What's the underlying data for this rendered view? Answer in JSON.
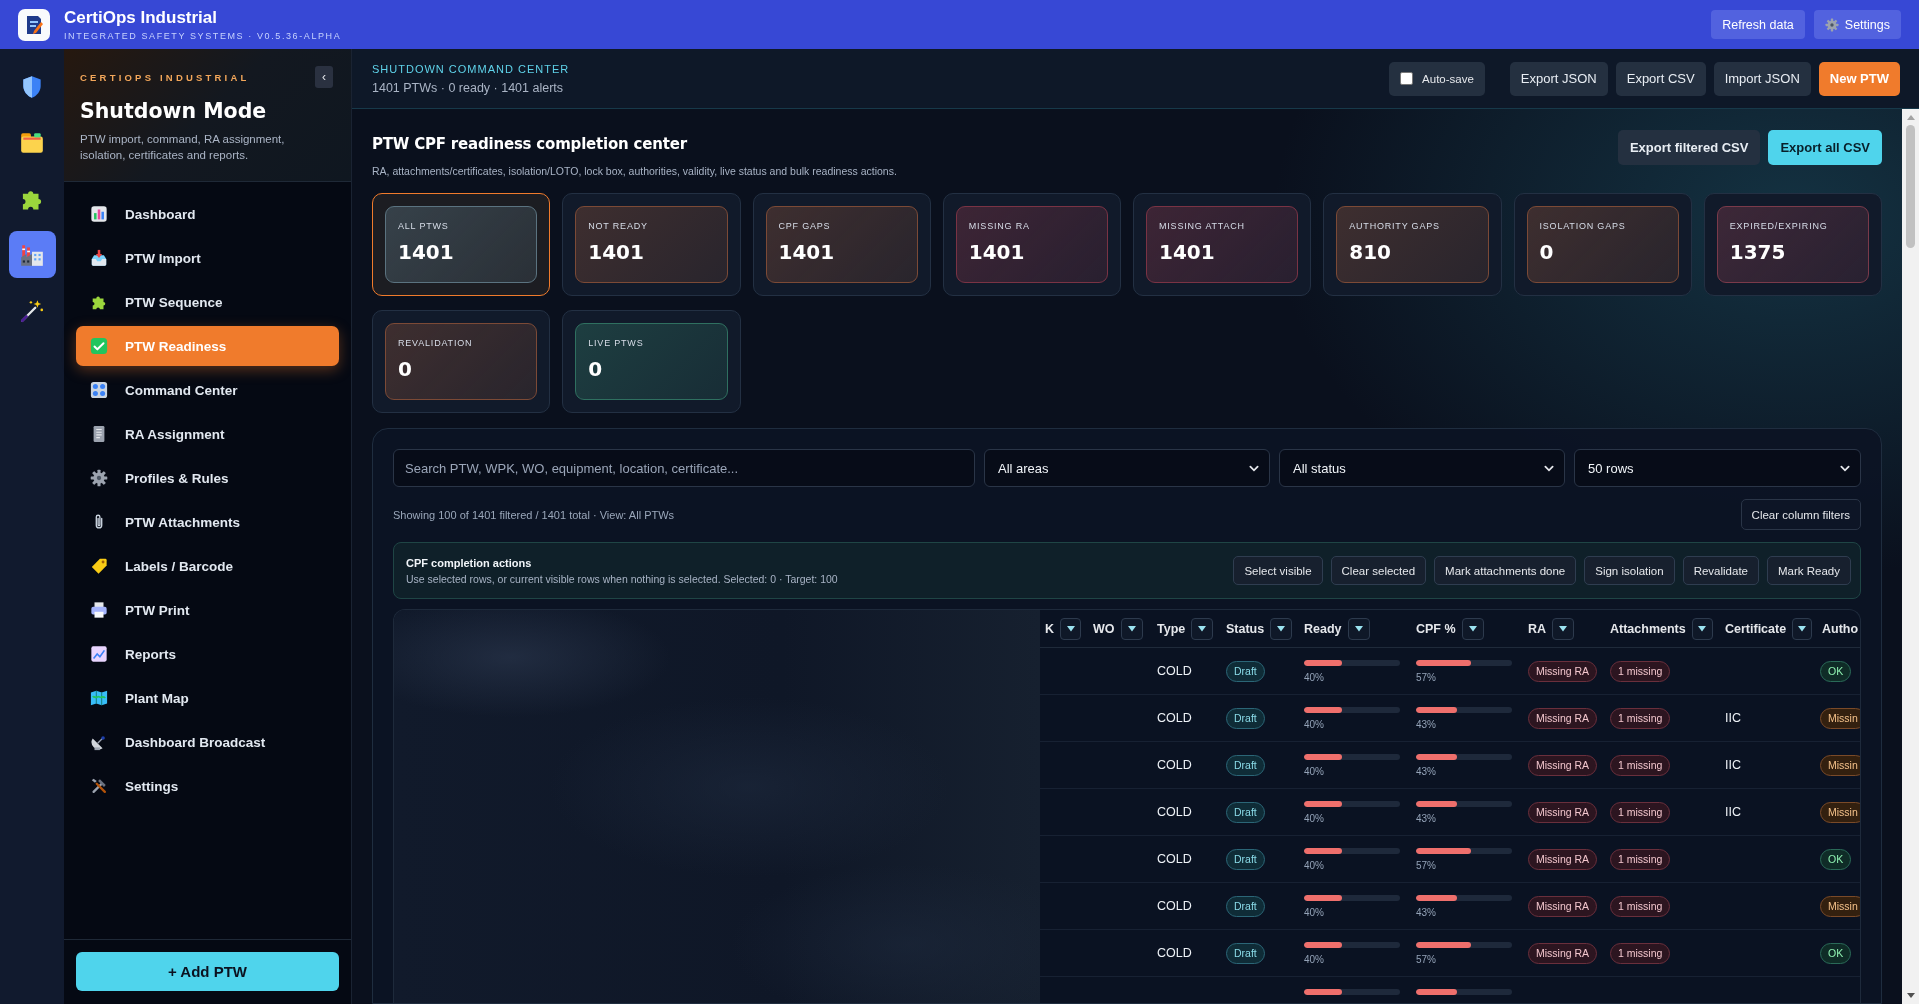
{
  "app_bar": {
    "title": "CertiOps Industrial",
    "subtitle": "INTEGRATED SAFETY SYSTEMS · V0.5.36-ALPHA",
    "buttons": [
      {
        "label": "Refresh data",
        "kind": "text"
      },
      {
        "label": "Settings",
        "kind": "icon_text"
      }
    ]
  },
  "rail_items": [
    {
      "selected": false
    },
    {
      "selected": false
    },
    {
      "selected": false
    },
    {
      "selected": true
    },
    {
      "selected": false
    }
  ],
  "sidebar": {
    "eyebrow": "CERTIOPS INDUSTRIAL",
    "collapse_button": "‹",
    "title": "Shutdown Mode",
    "description": "PTW import, command, RA assignment, isolation, certificates and reports.",
    "items": [
      {
        "label": "Dashboard",
        "selected": false
      },
      {
        "label": "PTW Import",
        "selected": false
      },
      {
        "label": "PTW Sequence",
        "selected": false
      },
      {
        "label": "PTW Readiness",
        "selected": true
      },
      {
        "label": "Command Center",
        "selected": false
      },
      {
        "label": "RA Assignment",
        "selected": false
      },
      {
        "label": "Profiles & Rules",
        "selected": false
      },
      {
        "label": "PTW Attachments",
        "selected": false
      },
      {
        "label": "Labels / Barcode",
        "selected": false
      },
      {
        "label": "PTW Print",
        "selected": false
      },
      {
        "label": "Reports",
        "selected": false
      },
      {
        "label": "Plant Map",
        "selected": false
      },
      {
        "label": "Dashboard Broadcast",
        "selected": false
      },
      {
        "label": "Settings",
        "selected": false
      }
    ],
    "add_button": "+ Add PTW"
  },
  "header": {
    "eyebrow": "SHUTDOWN COMMAND CENTER",
    "summary": "1401 PTWs · 0 ready · 1401 alerts",
    "auto_save": {
      "label": "Auto-save",
      "checked": false
    },
    "buttons": [
      {
        "label": "Export JSON",
        "kind": "secondary"
      },
      {
        "label": "Export CSV",
        "kind": "secondary"
      },
      {
        "label": "Import JSON",
        "kind": "secondary"
      },
      {
        "label": "New PTW",
        "kind": "primary"
      }
    ]
  },
  "section": {
    "title": "PTW CPF readiness completion center",
    "subtitle": "RA, attachments/certificates, isolation/LOTO, lock box, authorities, validity, live status and bulk readiness actions.",
    "buttons": [
      {
        "label": "Export filtered CSV",
        "kind": "secondary"
      },
      {
        "label": "Export all CSV",
        "kind": "accent"
      }
    ]
  },
  "kpis": [
    {
      "label": "ALL PTWS",
      "value": "1401",
      "color": "#5b7380",
      "selected": true
    },
    {
      "label": "NOT READY",
      "value": "1401",
      "color": "#7c4a36",
      "selected": false
    },
    {
      "label": "CPF GAPS",
      "value": "1401",
      "color": "#7c4a36",
      "selected": false
    },
    {
      "label": "MISSING RA",
      "value": "1401",
      "color": "#7a3344",
      "selected": false
    },
    {
      "label": "MISSING ATTACH",
      "value": "1401",
      "color": "#7a3344",
      "selected": false
    },
    {
      "label": "AUTHORITY GAPS",
      "value": "810",
      "color": "#7c4a36",
      "selected": false
    },
    {
      "label": "ISOLATION GAPS",
      "value": "0",
      "color": "#7c4a36",
      "selected": false
    },
    {
      "label": "EXPIRED/EXPIRING",
      "value": "1375",
      "color": "#7a3a4a",
      "selected": false
    },
    {
      "label": "REVALIDATION",
      "value": "0",
      "color": "#7c4a36",
      "selected": false
    },
    {
      "label": "LIVE PTWS",
      "value": "0",
      "color": "#2f7060",
      "selected": false
    }
  ],
  "filters": {
    "search": {
      "placeholder": "Search PTW, WPK, WO, equipment, location, certificate..."
    },
    "selects": [
      {
        "value": "All areas"
      },
      {
        "value": "All status"
      },
      {
        "value": "50 rows"
      }
    ],
    "summary": "Showing 100 of 1401 filtered / 1401 total · View: All PTWs",
    "clear_button": "Clear column filters"
  },
  "actions": {
    "title": "CPF completion actions",
    "hint": "Use selected rows, or current visible rows when nothing is selected. Selected: 0 · Target: 100",
    "buttons": [
      "Select visible",
      "Clear selected",
      "Mark attachments done",
      "Sign isolation",
      "Revalidate",
      "Mark Ready"
    ]
  },
  "table": {
    "columns": [
      "K",
      "WO",
      "Type",
      "Status",
      "Ready",
      "CPF %",
      "RA",
      "Attachments",
      "Certificate",
      "Autho"
    ],
    "rows": [
      {
        "type": "COLD",
        "status": "Draft",
        "ready": {
          "level": 0.4,
          "reading": "40%"
        },
        "cpf": {
          "level": 0.57,
          "reading": "57%"
        },
        "ra": "Missing RA",
        "attachments": "1 missing",
        "authority": {
          "label": "OK",
          "kind": "ok"
        }
      },
      {
        "type": "COLD",
        "status": "Draft",
        "ready": {
          "level": 0.4,
          "reading": "40%"
        },
        "cpf": {
          "level": 0.43,
          "reading": "43%"
        },
        "ra": "Missing RA",
        "attachments": "1 missing",
        "certificate": "IIC",
        "authority": {
          "label": "Missin",
          "kind": "missing"
        }
      },
      {
        "type": "COLD",
        "status": "Draft",
        "ready": {
          "level": 0.4,
          "reading": "40%"
        },
        "cpf": {
          "level": 0.43,
          "reading": "43%"
        },
        "ra": "Missing RA",
        "attachments": "1 missing",
        "certificate": "IIC",
        "authority": {
          "label": "Missin",
          "kind": "missing"
        }
      },
      {
        "type": "COLD",
        "status": "Draft",
        "ready": {
          "level": 0.4,
          "reading": "40%"
        },
        "cpf": {
          "level": 0.43,
          "reading": "43%"
        },
        "ra": "Missing RA",
        "attachments": "1 missing",
        "certificate": "IIC",
        "authority": {
          "label": "Missin",
          "kind": "missing"
        }
      },
      {
        "type": "COLD",
        "status": "Draft",
        "ready": {
          "level": 0.4,
          "reading": "40%"
        },
        "cpf": {
          "level": 0.57,
          "reading": "57%"
        },
        "ra": "Missing RA",
        "attachments": "1 missing",
        "authority": {
          "label": "OK",
          "kind": "ok"
        }
      },
      {
        "type": "COLD",
        "status": "Draft",
        "ready": {
          "level": 0.4,
          "reading": "40%"
        },
        "cpf": {
          "level": 0.43,
          "reading": "43%"
        },
        "ra": "Missing RA",
        "attachments": "1 missing",
        "authority": {
          "label": "Missin",
          "kind": "missing"
        }
      },
      {
        "type": "COLD",
        "status": "Draft",
        "ready": {
          "level": 0.4,
          "reading": "40%"
        },
        "cpf": {
          "level": 0.57,
          "reading": "57%"
        },
        "ra": "Missing RA",
        "attachments": "1 missing",
        "authority": {
          "label": "OK",
          "kind": "ok"
        }
      },
      {
        "ready": {
          "level": 0.4
        },
        "cpf": {
          "level": 0.43
        }
      }
    ]
  }
}
